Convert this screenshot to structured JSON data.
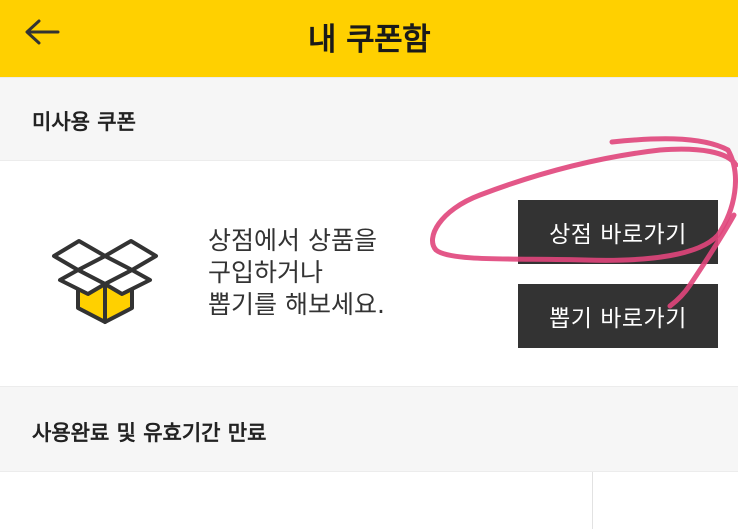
{
  "header": {
    "title": "내 쿠폰함",
    "back_icon": "arrow-left-icon",
    "background": "#ffd000"
  },
  "unused_section": {
    "label": "미사용 쿠폰"
  },
  "empty_state": {
    "icon": "open-box-icon",
    "message_lines": [
      "상점에서 상품을",
      "구입하거나",
      "뽑기를 해보세요."
    ],
    "store_button": "상점 바로가기",
    "pick_button": "뽑기 바로가기"
  },
  "expired_section": {
    "label": "사용완료 및 유효기간 만료"
  },
  "colors": {
    "accent": "#ffd000",
    "button": "#333333",
    "annotation": "#e0457b"
  }
}
